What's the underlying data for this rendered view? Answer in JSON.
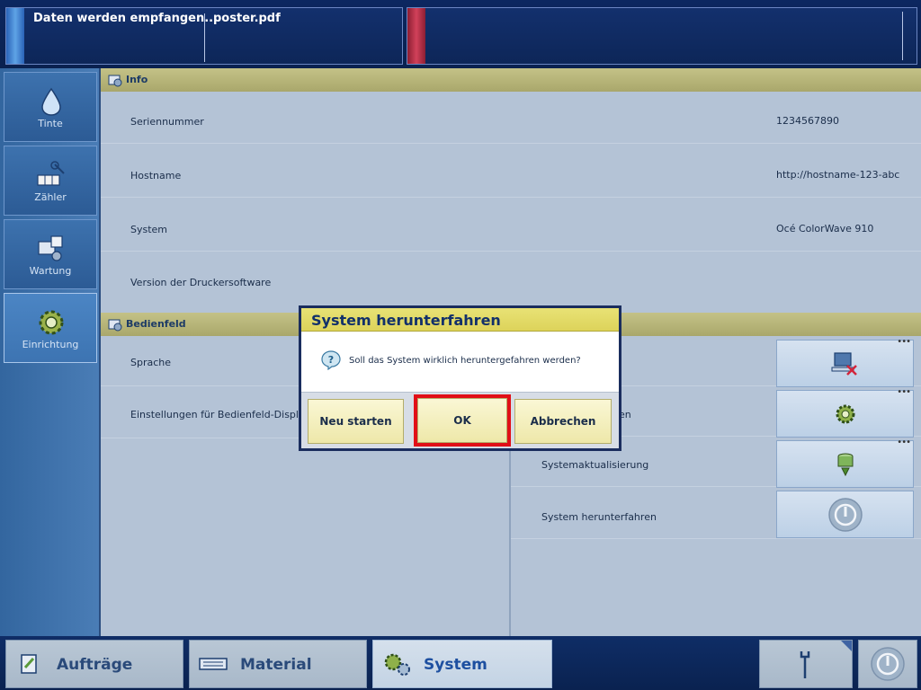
{
  "status": {
    "left": {
      "message": "Daten werden empfangen...",
      "file": "poster.pdf"
    },
    "right": {
      "message": ""
    }
  },
  "sidebar": {
    "items": [
      {
        "label": "Tinte",
        "icon": "ink-drop-icon"
      },
      {
        "label": "Zähler",
        "icon": "counter-icon"
      },
      {
        "label": "Wartung",
        "icon": "maintenance-icon"
      },
      {
        "label": "Einrichtung",
        "icon": "settings-gear-icon",
        "active": true
      }
    ]
  },
  "info": {
    "title": "Info",
    "rows": [
      {
        "label": "Seriennummer",
        "value": "1234567890"
      },
      {
        "label": "Hostname",
        "value": "http://hostname-123-abc"
      },
      {
        "label": "System",
        "value": "Océ ColorWave 910"
      },
      {
        "label": "Version der Druckersoftware",
        "value": ""
      }
    ]
  },
  "bedienfeld": {
    "title": "Bedienfeld",
    "rows": [
      {
        "label": "Sprache"
      },
      {
        "label": "Einstellungen für Bedienfeld-Display"
      }
    ]
  },
  "system_section": {
    "rows": [
      {
        "label": "",
        "icon": "remote-monitor-icon"
      },
      {
        "label": "en",
        "icon": "gear-icon"
      },
      {
        "label": "Systemaktualisierung",
        "icon": "download-update-icon"
      },
      {
        "label": "System herunterfahren",
        "icon": "power-icon"
      }
    ]
  },
  "bottom": {
    "tabs": [
      {
        "label": "Aufträge"
      },
      {
        "label": "Material"
      },
      {
        "label": "System",
        "active": true
      }
    ]
  },
  "dialog": {
    "title": "System herunterfahren",
    "message": "Soll das System wirklich heruntergefahren werden?",
    "buttons": {
      "restart": "Neu starten",
      "ok": "OK",
      "cancel": "Abbrechen"
    }
  },
  "colors": {
    "header_bar": "#0c2760",
    "section_header": "#c4c287",
    "dialog_title": "#e8e275",
    "highlight": "#e10f17"
  }
}
